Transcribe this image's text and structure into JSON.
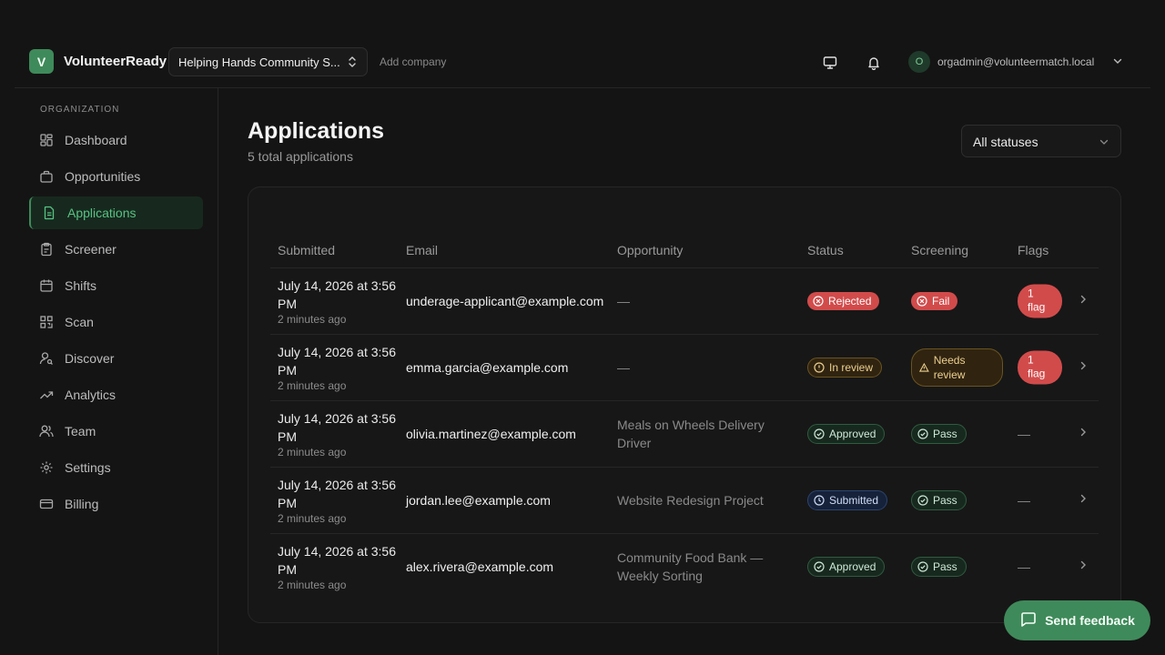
{
  "app": {
    "logo_letter": "V",
    "name": "VolunteerReady"
  },
  "header": {
    "company": "Helping Hands Community S...",
    "add_company": "Add company",
    "user_initial": "O",
    "user_email": "orgadmin@volunteermatch.local"
  },
  "sidebar": {
    "heading": "ORGANIZATION",
    "items": [
      {
        "label": "Dashboard",
        "icon": "dashboard-icon"
      },
      {
        "label": "Opportunities",
        "icon": "briefcase-icon"
      },
      {
        "label": "Applications",
        "icon": "document-icon",
        "active": true
      },
      {
        "label": "Screener",
        "icon": "clipboard-icon"
      },
      {
        "label": "Shifts",
        "icon": "calendar-icon"
      },
      {
        "label": "Scan",
        "icon": "qr-code-icon"
      },
      {
        "label": "Discover",
        "icon": "user-search-icon"
      },
      {
        "label": "Analytics",
        "icon": "trending-up-icon"
      },
      {
        "label": "Team",
        "icon": "users-icon"
      },
      {
        "label": "Settings",
        "icon": "gear-icon"
      },
      {
        "label": "Billing",
        "icon": "credit-card-icon"
      }
    ]
  },
  "main": {
    "title": "Applications",
    "subtitle": "5 total applications",
    "status_filter": "All statuses"
  },
  "table": {
    "columns": {
      "submitted": "Submitted",
      "email": "Email",
      "opportunity": "Opportunity",
      "status": "Status",
      "screening": "Screening",
      "flags": "Flags"
    },
    "rows": [
      {
        "date": "July 14, 2026 at 3:56 PM",
        "ago": "2 minutes ago",
        "email": "underage-applicant@example.com",
        "opportunity": "—",
        "status": "Rejected",
        "status_color": "#d24b4b",
        "screening": "Fail",
        "screening_color": "#d24b4b",
        "flags": "1 flag"
      },
      {
        "date": "July 14, 2026 at 3:56 PM",
        "ago": "2 minutes ago",
        "email": "emma.garcia@example.com",
        "opportunity": "—",
        "status": "In review",
        "status_color": "#eccf8f",
        "screening": "Needs review",
        "screening_color": "#eccf8f",
        "flags": "1 flag"
      },
      {
        "date": "July 14, 2026 at 3:56 PM",
        "ago": "2 minutes ago",
        "email": "olivia.martinez@example.com",
        "opportunity": "Meals on Wheels Delivery Driver",
        "status": "Approved",
        "status_color": "#58c283",
        "screening": "Pass",
        "screening_color": "#58c283",
        "flags": "—"
      },
      {
        "date": "July 14, 2026 at 3:56 PM",
        "ago": "2 minutes ago",
        "email": "jordan.lee@example.com",
        "opportunity": "Website Redesign Project",
        "status": "Submitted",
        "status_color": "#6f95e0",
        "screening": "Pass",
        "screening_color": "#58c283",
        "flags": "—"
      },
      {
        "date": "July 14, 2026 at 3:56 PM",
        "ago": "2 minutes ago",
        "email": "alex.rivera@example.com",
        "opportunity": "Community Food Bank — Weekly Sorting",
        "status": "Approved",
        "status_color": "#58c283",
        "screening": "Pass",
        "screening_color": "#58c283",
        "flags": "—"
      }
    ]
  },
  "feedback": {
    "label": "Send feedback"
  }
}
